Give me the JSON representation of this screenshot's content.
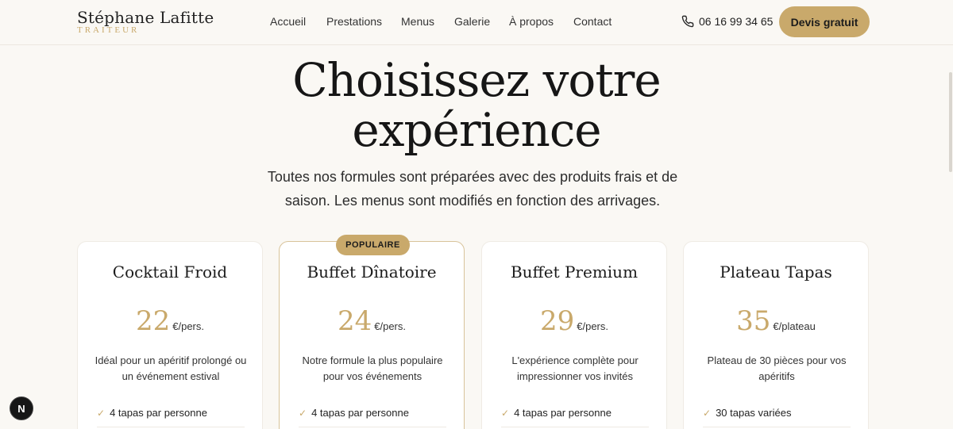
{
  "brand": {
    "name": "Stéphane Lafitte",
    "tagline": "TRAITEUR"
  },
  "nav": [
    "Accueil",
    "Prestations",
    "Menus",
    "Galerie",
    "À propos",
    "Contact"
  ],
  "phone": {
    "icon": "phone-icon",
    "number": "06 16 99 34 65"
  },
  "cta_label": "Devis gratuit",
  "hero": {
    "title_line1": "Choisissez votre",
    "title_line2": "expérience",
    "subtitle_line1": "Toutes nos formules sont préparées avec des produits frais et de",
    "subtitle_line2": "saison. Les menus sont modifiés en fonction des arrivages."
  },
  "cards": [
    {
      "title": "Cocktail Froid",
      "price": "22",
      "unit": "€/pers.",
      "desc": "Idéal pour un apéritif prolongé ou un événement estival",
      "feature": "4 tapas par personne",
      "badge": ""
    },
    {
      "title": "Buffet Dînatoire",
      "price": "24",
      "unit": "€/pers.",
      "desc": "Notre formule la plus populaire pour vos événements",
      "feature": "4 tapas par personne",
      "badge": "POPULAIRE"
    },
    {
      "title": "Buffet Premium",
      "price": "29",
      "unit": "€/pers.",
      "desc": "L'expérience complète pour impressionner vos invités",
      "feature": "4 tapas par personne",
      "badge": ""
    },
    {
      "title": "Plateau Tapas",
      "price": "35",
      "unit": "€/plateau",
      "desc": "Plateau de 30 pièces pour vos apéritifs",
      "feature": "30 tapas variées",
      "badge": ""
    }
  ],
  "dev_indicator": "N",
  "colors": {
    "accent": "#c9a96b",
    "background": "#faf8f4",
    "text": "#1c1c1c"
  }
}
